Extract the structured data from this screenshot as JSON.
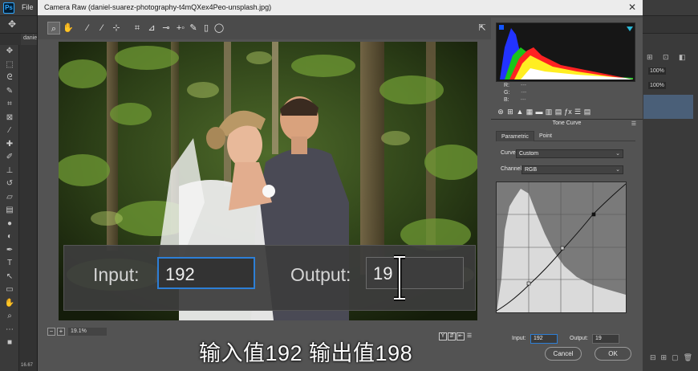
{
  "photoshop": {
    "logo": "Ps",
    "menu_first": "File",
    "doc_tab": "danie",
    "panel_pct_1": "100%",
    "panel_pct_2": "100%",
    "bottom_status": "16.67"
  },
  "dialog": {
    "title": "Camera Raw (daniel-suarez-photography-t4mQXex4Peo-unsplash.jpg)",
    "zoom_value": "19.1%",
    "zoom_minus": "−",
    "zoom_plus": "+"
  },
  "overlay": {
    "input_label": "Input:",
    "input_value": "192",
    "output_label": "Output:",
    "output_value": "19"
  },
  "subtitle": "输入值192 输出值198",
  "right_panel": {
    "rgb": {
      "r_label": "R:",
      "g_label": "G:",
      "b_label": "B:",
      "r_value": "---",
      "g_value": "---",
      "b_value": "---"
    },
    "section_title": "Tone Curve",
    "tabs": [
      {
        "label": "Parametric"
      },
      {
        "label": "Point"
      }
    ],
    "curve_label": "Curve:",
    "curve_value": "Custom",
    "channel_label": "Channel:",
    "channel_value": "RGB",
    "input_label": "Input:",
    "input_value": "192",
    "output_label": "Output:",
    "output_value": "19",
    "cancel_label": "Cancel",
    "ok_label": "OK"
  },
  "colors": {
    "accent_blue": "#2d7fd6",
    "dialog_bg": "#535353",
    "title_bar": "#ececec"
  },
  "icons": [
    "zoom-icon",
    "hand-icon",
    "white-balance-icon",
    "color-sampler-icon",
    "target-adjust-icon",
    "crop-icon",
    "straighten-icon",
    "spot-removal-icon",
    "red-eye-icon",
    "adjustment-brush-icon",
    "graduated-filter-icon",
    "radial-filter-icon",
    "open-preferences-icon"
  ]
}
